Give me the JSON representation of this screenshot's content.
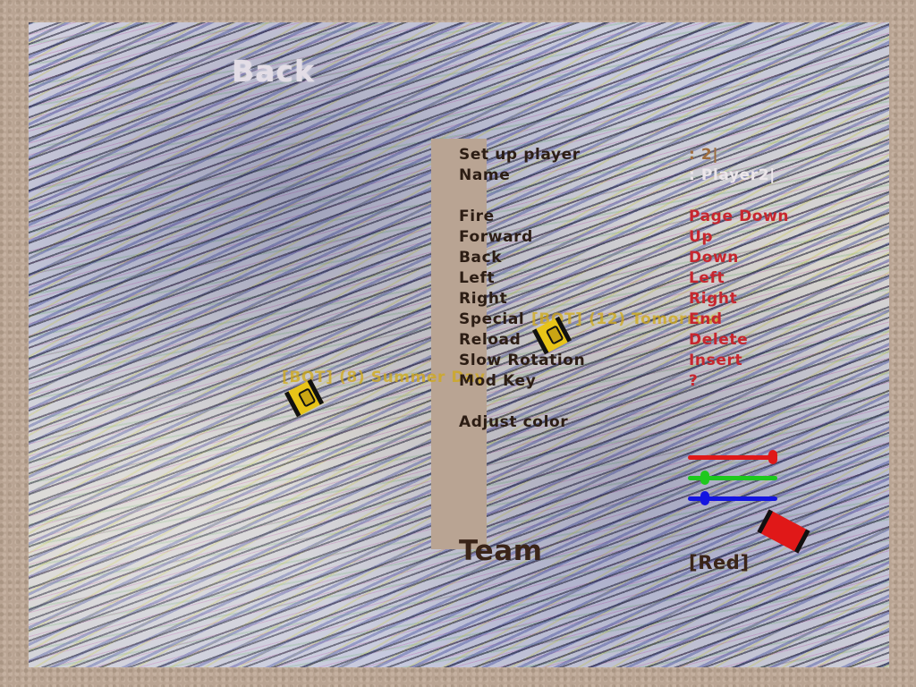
{
  "menu": {
    "back_label": "Back",
    "setup_player_label": "Set up player",
    "setup_player_value": ": 2|",
    "name_label": "Name",
    "name_value": ": Player2|",
    "keys": [
      {
        "label": "Fire",
        "value": "Page Down"
      },
      {
        "label": "Forward",
        "value": "Up"
      },
      {
        "label": "Back",
        "value": "Down"
      },
      {
        "label": "Left",
        "value": "Left"
      },
      {
        "label": "Right",
        "value": "Right"
      },
      {
        "label": "Special",
        "value": "End"
      },
      {
        "label": "Reload",
        "value": "Delete"
      },
      {
        "label": "Slow Rotation",
        "value": "Insert"
      },
      {
        "label": "Mod Key",
        "value": "?"
      }
    ],
    "adjust_color_label": "Adjust color",
    "team_label": "Team",
    "team_value": "[Red]"
  },
  "color_sliders": {
    "red": {
      "color": "#e01818",
      "level": 1.0
    },
    "green": {
      "color": "#1ec81e",
      "level": 0.15
    },
    "blue": {
      "color": "#1414e0",
      "level": 0.15
    }
  },
  "bots": [
    {
      "label": "[BOT] (12) Tomorrow",
      "icon": "tank-icon"
    },
    {
      "label": "[BOT] (8) Summer Day",
      "icon": "tank-icon"
    }
  ],
  "colors": {
    "key_value": "#c8262e",
    "bot_label": "#d2aa14",
    "team_flag": "#e01818"
  }
}
